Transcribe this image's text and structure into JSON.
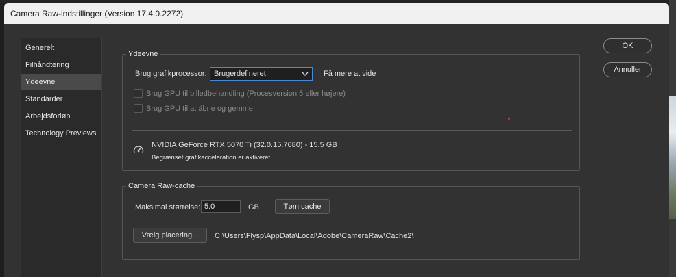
{
  "window": {
    "title": "Camera Raw-indstillinger  (Version 17.4.0.2272)"
  },
  "sidebar": {
    "items": [
      {
        "label": "Generelt"
      },
      {
        "label": "Filhåndtering"
      },
      {
        "label": "Ydeevne",
        "active": true
      },
      {
        "label": "Standarder"
      },
      {
        "label": "Arbejdsforløb"
      },
      {
        "label": "Technology Previews"
      }
    ]
  },
  "performance": {
    "title": "Ydeevne",
    "gpu_label": "Brug grafikprocessor:",
    "gpu_select_value": "Brugerdefineret",
    "learn_more": "Få mere at vide",
    "use_gpu_image_processing": "Brug GPU til billedbehandling (Procesversion 5 eller højere)",
    "use_gpu_open_save": "Brug GPU til at åbne og gemme",
    "gpu_name": "NVIDIA GeForce RTX 5070 Ti (32.0.15.7680) - 15.5 GB",
    "gpu_status": "Begrænset grafikacceleration er aktiveret."
  },
  "cache": {
    "title": "Camera Raw-cache",
    "max_size_label": "Maksimal størrelse:",
    "max_size_value": "5.0",
    "unit": "GB",
    "purge_button": "Tøm cache",
    "choose_location_button": "Vælg placering...",
    "path": "C:\\Users\\Flysp\\AppData\\Local\\Adobe\\CameraRaw\\Cache2\\"
  },
  "buttons": {
    "ok": "OK",
    "cancel": "Annuller"
  },
  "colors": {
    "dialog_bg": "#323232",
    "select_border": "#4a8ad4",
    "titlebar_bg": "#f0f0f0"
  }
}
